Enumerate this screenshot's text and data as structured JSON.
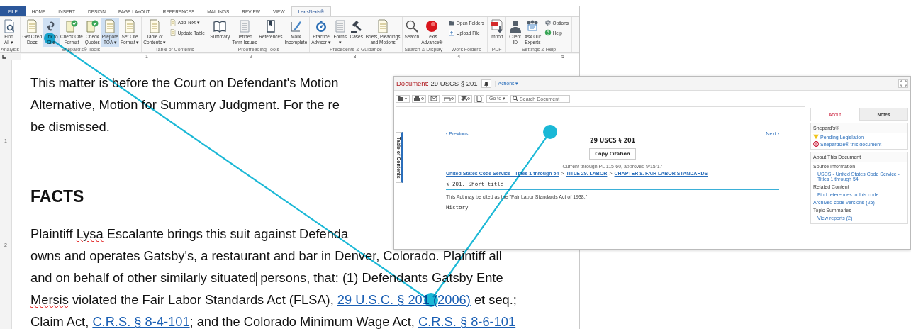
{
  "word": {
    "tabs": [
      {
        "label": "FILE",
        "kind": "file",
        "selected": false
      },
      {
        "label": "HOME",
        "kind": "tab",
        "selected": false
      },
      {
        "label": "INSERT",
        "kind": "tab",
        "selected": false
      },
      {
        "label": "DESIGN",
        "kind": "tab",
        "selected": false
      },
      {
        "label": "PAGE LAYOUT",
        "kind": "tab",
        "selected": false
      },
      {
        "label": "REFERENCES",
        "kind": "tab",
        "selected": false
      },
      {
        "label": "MAILINGS",
        "kind": "tab",
        "selected": false
      },
      {
        "label": "REVIEW",
        "kind": "tab",
        "selected": false
      },
      {
        "label": "VIEW",
        "kind": "tab",
        "selected": false
      },
      {
        "label": "LexisNexis®",
        "kind": "tab",
        "selected": true
      }
    ],
    "ribbon_groups": [
      {
        "label": "Analysis",
        "items": [
          {
            "kind": "large",
            "lines": [
              "Find",
              "All ▾"
            ],
            "selected": false
          }
        ]
      },
      {
        "label": "Shepard's® Tools",
        "items": [
          {
            "kind": "large",
            "lines": [
              "Get Cited",
              "Docs"
            ],
            "selected": false
          },
          {
            "kind": "large",
            "lines": [
              "Link to",
              "Cite"
            ],
            "selected": true
          },
          {
            "kind": "large",
            "lines": [
              "Check Cite",
              "Format"
            ],
            "selected": false
          },
          {
            "kind": "large",
            "lines": [
              "Check",
              "Quotes"
            ],
            "selected": false
          },
          {
            "kind": "large",
            "lines": [
              "Prepare",
              "TOA ▾"
            ],
            "selected": true
          },
          {
            "kind": "large",
            "lines": [
              "Set Cite",
              "Format ▾"
            ],
            "selected": false
          }
        ]
      },
      {
        "label": "Table of Contents",
        "items": [
          {
            "kind": "large",
            "lines": [
              "Table of",
              "Contents ▾"
            ],
            "selected": false
          },
          {
            "kind": "stack",
            "buttons": [
              {
                "label": "Add Text ▾"
              },
              {
                "label": "Update Table"
              }
            ]
          }
        ]
      },
      {
        "label": "Proofreading Tools",
        "items": [
          {
            "kind": "large",
            "lines": [
              "Summary"
            ],
            "selected": false
          },
          {
            "kind": "large",
            "lines": [
              "Defined",
              "Term Issues"
            ],
            "selected": false
          },
          {
            "kind": "large",
            "lines": [
              "References"
            ],
            "selected": false
          },
          {
            "kind": "large",
            "lines": [
              "Mark",
              "Incomplete"
            ],
            "selected": false
          }
        ]
      },
      {
        "label": "Precedents & Guidance",
        "items": [
          {
            "kind": "large",
            "lines": [
              "Practice",
              "Advisor ▾"
            ],
            "selected": false
          },
          {
            "kind": "large",
            "lines": [
              "Forms",
              "▾"
            ],
            "selected": false
          },
          {
            "kind": "large",
            "lines": [
              "Cases"
            ],
            "selected": false
          },
          {
            "kind": "large",
            "lines": [
              "Briefs, Pleadings",
              "and Motions"
            ],
            "selected": false
          }
        ]
      },
      {
        "label": "Search & Display",
        "items": [
          {
            "kind": "large",
            "lines": [
              "Search"
            ],
            "selected": false
          },
          {
            "kind": "large",
            "lines": [
              "Lexis",
              "Advance®"
            ],
            "selected": false
          }
        ]
      },
      {
        "label": "Work Folders",
        "items": [
          {
            "kind": "stack",
            "buttons": [
              {
                "label": "Open Folders"
              },
              {
                "label": "Upload File"
              }
            ]
          }
        ]
      },
      {
        "label": "PDF",
        "items": [
          {
            "kind": "large",
            "lines": [
              "Import"
            ],
            "selected": false
          }
        ]
      },
      {
        "label": "Settings & Help",
        "items": [
          {
            "kind": "large",
            "lines": [
              "Client",
              "ID"
            ],
            "selected": false
          },
          {
            "kind": "large",
            "lines": [
              "Ask Our",
              "Experts"
            ],
            "selected": false
          },
          {
            "kind": "stack",
            "buttons": [
              {
                "label": "Options"
              },
              {
                "label": "Help"
              }
            ]
          }
        ]
      }
    ],
    "ruler": [
      "1",
      "2",
      "3",
      "4",
      "5"
    ],
    "vertical_ruler": [
      "1",
      "2"
    ],
    "document": [
      {
        "kind": "body",
        "segments": [
          {
            "kind": "text",
            "text": "This matter is before the Court on Defendant's Motion"
          }
        ]
      },
      {
        "kind": "body",
        "segments": [
          {
            "kind": "text",
            "text": "Alternative, Motion for Summary Judgment. For the re"
          }
        ]
      },
      {
        "kind": "body",
        "segments": [
          {
            "kind": "text",
            "text": "be dismissed."
          }
        ]
      },
      {
        "kind": "heading",
        "segments": [
          {
            "kind": "text",
            "text": "FACTS"
          }
        ]
      },
      {
        "kind": "body",
        "segments": [
          {
            "kind": "text",
            "text": "Plaintiff "
          },
          {
            "kind": "misspelled",
            "text": "Lysa"
          },
          {
            "kind": "text",
            "text": " Escalante brings this suit against Defenda"
          }
        ]
      },
      {
        "kind": "body",
        "segments": [
          {
            "kind": "text",
            "text": "owns and operates Gatsby's, a restaurant and bar in Denver, Colorado. Plaintiff all"
          }
        ]
      },
      {
        "kind": "body",
        "segments": [
          {
            "kind": "text",
            "text": "and on behalf of other similarly situated"
          },
          {
            "kind": "cursor"
          },
          {
            "kind": "text",
            "text": " persons, that: (1) Defendants Gatsby Ente"
          }
        ]
      },
      {
        "kind": "body",
        "segments": [
          {
            "kind": "misspelled",
            "text": "Mersis"
          },
          {
            "kind": "text",
            "text": " violated the Fair Labor Standards Act (FLSA), "
          },
          {
            "kind": "link",
            "text": "29 U.S.C. § 201 (2006)",
            "callout": true
          },
          {
            "kind": "text",
            "text": " et seq.;"
          }
        ]
      },
      {
        "kind": "body",
        "segments": [
          {
            "kind": "text",
            "text": "Claim Act, "
          },
          {
            "kind": "link",
            "text": "C.R.S. § 8-4-101"
          },
          {
            "kind": "text",
            "text": "; and the Colorado Minimum Wage Act, "
          },
          {
            "kind": "link",
            "text": "C.R.S. § 8-6-101"
          }
        ]
      }
    ]
  },
  "lexis": {
    "document_label": "Document:",
    "document_title": "29 USCS § 201",
    "actions": "Actions ▾",
    "goto": "Go to ▾",
    "search_placeholder": "Search Document",
    "toc_tab": "Table of Contents",
    "previous": "‹ Previous",
    "next": "Next ›",
    "title": "29 USCS § 201",
    "copy_button": "Copy Citation",
    "currency": "Current through PL 115-60, approved 9/15/17",
    "breadcrumb": [
      {
        "kind": "link",
        "text": "United States Code Service - Titles 1 through 54"
      },
      {
        "kind": "separator",
        "text": ">"
      },
      {
        "kind": "link",
        "text": "TITLE 29. LABOR"
      },
      {
        "kind": "separator",
        "text": ">"
      },
      {
        "kind": "link",
        "text": "CHAPTER 8. FAIR LABOR STANDARDS"
      }
    ],
    "section_heading": "§ 201. Short title",
    "section_text": "This Act may be cited as the \"Fair Labor Standards Act of 1938.\"",
    "history_heading": "History",
    "panel_tabs": [
      {
        "label": "About",
        "selected": true
      },
      {
        "label": "Notes",
        "selected": false
      }
    ],
    "shepards": {
      "title": "Shepard's®",
      "items": [
        {
          "kind": "warning",
          "text": "Pending Legislation"
        },
        {
          "kind": "alert",
          "text": "Shepardize® this document"
        }
      ]
    },
    "about": {
      "title": "About This Document",
      "items": [
        {
          "kind": "label",
          "text": "Source Information"
        },
        {
          "kind": "indented-link",
          "text": "USCS - United States Code Service - Titles 1 through 54"
        },
        {
          "kind": "label",
          "text": "Related Content"
        },
        {
          "kind": "indented-link",
          "text": "Find references to this code"
        },
        {
          "kind": "link",
          "text": "Archived code versions (25)"
        },
        {
          "kind": "label",
          "text": "Topic Summaries"
        },
        {
          "kind": "indented-link",
          "text": "View reports (2)"
        }
      ]
    }
  }
}
